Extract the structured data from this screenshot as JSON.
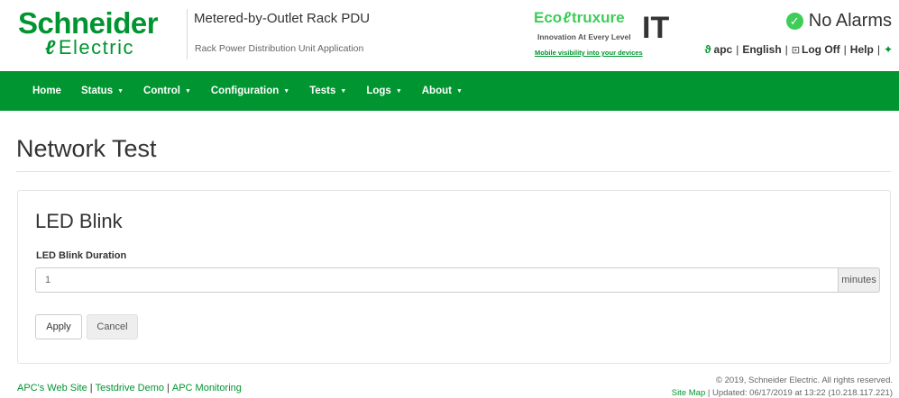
{
  "header": {
    "logo_top": "Schneider",
    "logo_bottom": "Electric",
    "app_title": "Metered-by-Outlet Rack PDU",
    "app_subtitle": "Rack Power Distribution Unit Application",
    "eco_prefix": "Eco",
    "eco_suffix": "truxure",
    "eco_it": "IT",
    "eco_tagline": "Innovation At Every Level",
    "eco_link": "Mobile visibility into your devices",
    "alarm_status": "No Alarms",
    "util": {
      "apc": "apc",
      "language": "English",
      "logoff": "Log Off",
      "help": "Help"
    }
  },
  "nav": {
    "items": [
      {
        "label": "Home",
        "dropdown": false
      },
      {
        "label": "Status",
        "dropdown": true
      },
      {
        "label": "Control",
        "dropdown": true
      },
      {
        "label": "Configuration",
        "dropdown": true
      },
      {
        "label": "Tests",
        "dropdown": true
      },
      {
        "label": "Logs",
        "dropdown": true
      },
      {
        "label": "About",
        "dropdown": true
      }
    ]
  },
  "page": {
    "title": "Network Test"
  },
  "panel": {
    "title": "LED Blink",
    "field_label": "LED Blink Duration",
    "field_value": "1",
    "field_unit": "minutes",
    "apply_label": "Apply",
    "cancel_label": "Cancel"
  },
  "footer": {
    "links": [
      "APC's Web Site",
      "Testdrive Demo",
      "APC Monitoring"
    ],
    "copyright": "© 2019, Schneider Electric. All rights reserved.",
    "site_map": "Site Map",
    "updated": "| Updated: 06/17/2019 at 13:22 (10.218.117.221)"
  },
  "colors": {
    "brand_green": "#009530",
    "accent_green": "#3dcd58"
  }
}
